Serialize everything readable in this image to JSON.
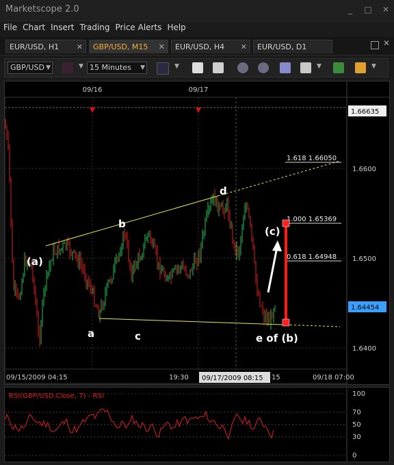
{
  "app": {
    "title": "Marketscope 2.0"
  },
  "menu": [
    "File",
    "Chart",
    "Insert",
    "Trading",
    "Price Alerts",
    "Help"
  ],
  "tabs": [
    {
      "label": "EUR/USD, H1",
      "active": false
    },
    {
      "label": "GBP/USD, M15",
      "active": true
    },
    {
      "label": "EUR/USD, H4",
      "active": false
    },
    {
      "label": "EUR/USD, D1",
      "active": false
    }
  ],
  "toolbar": {
    "symbol": "GBP/USD",
    "timeframe": "15 Minutes"
  },
  "chart": {
    "top_dates": [
      "09/16",
      "09/17"
    ],
    "price_ticks": [
      "1.6600",
      "1.6500",
      "1.6400"
    ],
    "top_price_label": "1.66635",
    "current_price_label": "1.64454",
    "time_labels": [
      "09/15/2009 04:15",
      "19:30",
      "09/17/2009 08:15",
      "15",
      "09/18 07:00"
    ],
    "fib_labels": [
      "1.618  1.66050",
      "1.000  1.65369",
      "0.618  1.64948"
    ],
    "wave_labels": [
      "(a)",
      "a",
      "b",
      "c",
      "d",
      "(c)",
      "e of (b)"
    ],
    "colors": {
      "up": "#22c25a",
      "down": "#e21e1e",
      "trendline": "#e8e84a",
      "target": "#ff1a1a"
    }
  },
  "rsi": {
    "title": "RSI(GBP/USD.Close, 7) - RSI",
    "levels": [
      "100",
      "70",
      "50",
      "30",
      "0"
    ]
  }
}
